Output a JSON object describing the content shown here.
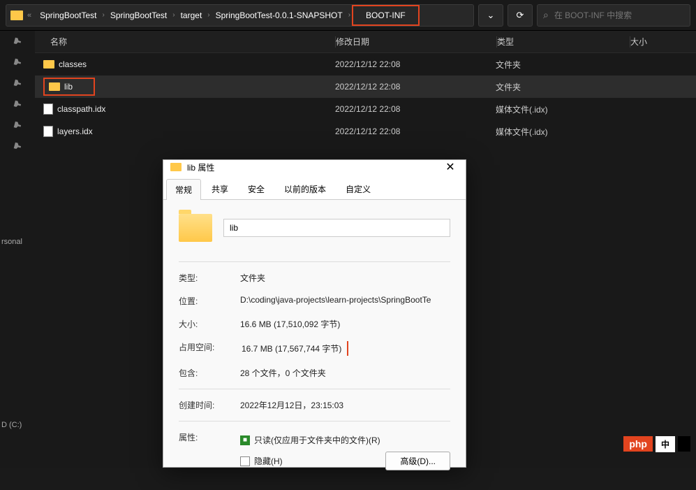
{
  "breadcrumb": {
    "items": [
      "SpringBootTest",
      "SpringBootTest",
      "target",
      "SpringBootTest-0.0.1-SNAPSHOT",
      "BOOT-INF"
    ],
    "highlight_index": 4
  },
  "search": {
    "placeholder": "在 BOOT-INF 中搜索"
  },
  "columns": {
    "name": "名称",
    "date": "修改日期",
    "type": "类型",
    "size": "大小"
  },
  "files": [
    {
      "name": "classes",
      "date": "2022/12/12 22:08",
      "type": "文件夹",
      "icon": "folder",
      "hl": false
    },
    {
      "name": "lib",
      "date": "2022/12/12 22:08",
      "type": "文件夹",
      "icon": "folder",
      "hl": true
    },
    {
      "name": "classpath.idx",
      "date": "2022/12/12 22:08",
      "type": "媒体文件(.idx)",
      "icon": "file",
      "hl": false
    },
    {
      "name": "layers.idx",
      "date": "2022/12/12 22:08",
      "type": "媒体文件(.idx)",
      "icon": "file",
      "hl": false
    }
  ],
  "sidebar": {
    "label_rsonal": "rsonal",
    "label_dc": "D (C:)"
  },
  "dialog": {
    "title": "lib 属性",
    "tabs": {
      "general": "常规",
      "share": "共享",
      "security": "安全",
      "prev": "以前的版本",
      "custom": "自定义"
    },
    "name": "lib",
    "labels": {
      "type": "类型:",
      "location": "位置:",
      "size": "大小:",
      "ondisk": "占用空间:",
      "contains": "包含:",
      "created": "创建时间:",
      "attrs": "属性:"
    },
    "values": {
      "type": "文件夹",
      "location": "D:\\coding\\java-projects\\learn-projects\\SpringBootTe",
      "size": "16.6 MB (17,510,092 字节)",
      "ondisk": "16.7 MB (17,567,744 字节)",
      "contains": "28 个文件，0 个文件夹",
      "created": "2022年12月12日，23:15:03"
    },
    "attrs": {
      "readonly": "只读(仅应用于文件夹中的文件)(R)",
      "hidden": "隐藏(H)",
      "advanced": "高级(D)..."
    }
  },
  "watermark": {
    "text1": "php",
    "text2": "中"
  }
}
